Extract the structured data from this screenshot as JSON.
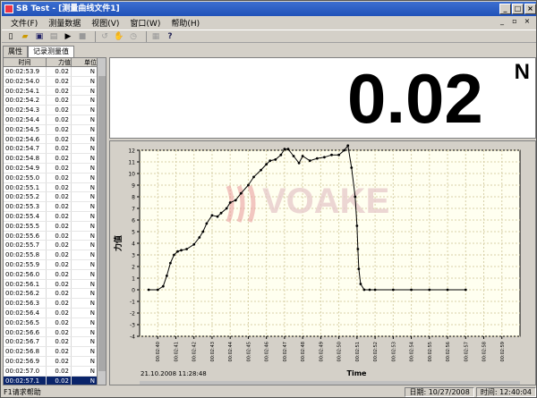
{
  "window": {
    "title": "SB Test - [测量曲线文件1]"
  },
  "menu": [
    "文件(F)",
    "测量数据",
    "视图(V)",
    "窗口(W)",
    "帮助(H)"
  ],
  "toolbar": [
    "new-icon",
    "open-icon",
    "save-icon",
    "print-icon",
    "play-icon",
    "stop-icon",
    "zoom-icon",
    "pan-icon",
    "refresh-icon",
    "export-icon",
    "help-icon"
  ],
  "tabs": [
    "属性",
    "记录测量值"
  ],
  "table": {
    "headers": [
      "时间",
      "力值",
      "单位"
    ],
    "rows": [
      [
        "00:02:53.9",
        "0.02",
        "N"
      ],
      [
        "00:02:54.0",
        "0.02",
        "N"
      ],
      [
        "00:02:54.1",
        "0.02",
        "N"
      ],
      [
        "00:02:54.2",
        "0.02",
        "N"
      ],
      [
        "00:02:54.3",
        "0.02",
        "N"
      ],
      [
        "00:02:54.4",
        "0.02",
        "N"
      ],
      [
        "00:02:54.5",
        "0.02",
        "N"
      ],
      [
        "00:02:54.6",
        "0.02",
        "N"
      ],
      [
        "00:02:54.7",
        "0.02",
        "N"
      ],
      [
        "00:02:54.8",
        "0.02",
        "N"
      ],
      [
        "00:02:54.9",
        "0.02",
        "N"
      ],
      [
        "00:02:55.0",
        "0.02",
        "N"
      ],
      [
        "00:02:55.1",
        "0.02",
        "N"
      ],
      [
        "00:02:55.2",
        "0.02",
        "N"
      ],
      [
        "00:02:55.3",
        "0.02",
        "N"
      ],
      [
        "00:02:55.4",
        "0.02",
        "N"
      ],
      [
        "00:02:55.5",
        "0.02",
        "N"
      ],
      [
        "00:02:55.6",
        "0.02",
        "N"
      ],
      [
        "00:02:55.7",
        "0.02",
        "N"
      ],
      [
        "00:02:55.8",
        "0.02",
        "N"
      ],
      [
        "00:02:55.9",
        "0.02",
        "N"
      ],
      [
        "00:02:56.0",
        "0.02",
        "N"
      ],
      [
        "00:02:56.1",
        "0.02",
        "N"
      ],
      [
        "00:02:56.2",
        "0.02",
        "N"
      ],
      [
        "00:02:56.3",
        "0.02",
        "N"
      ],
      [
        "00:02:56.4",
        "0.02",
        "N"
      ],
      [
        "00:02:56.5",
        "0.02",
        "N"
      ],
      [
        "00:02:56.6",
        "0.02",
        "N"
      ],
      [
        "00:02:56.7",
        "0.02",
        "N"
      ],
      [
        "00:02:56.8",
        "0.02",
        "N"
      ],
      [
        "00:02:56.9",
        "0.02",
        "N"
      ],
      [
        "00:02:57.0",
        "0.02",
        "N"
      ],
      [
        "00:02:57.1",
        "0.02",
        "N"
      ]
    ],
    "selected_index": 32
  },
  "display": {
    "value": "0.02",
    "unit": "N"
  },
  "watermark": "VOAKE",
  "chart_data": {
    "type": "line",
    "xlabel": "Time",
    "ylabel": "力值",
    "ylim": [
      -4,
      12
    ],
    "yticks": [
      -4,
      -3,
      -2,
      -1,
      0,
      1,
      2,
      3,
      4,
      5,
      6,
      7,
      8,
      9,
      10,
      11,
      12
    ],
    "xticks": [
      "00:02:40",
      "00:02:41",
      "00:02:42",
      "00:02:43",
      "00:02:44",
      "00:02:45",
      "00:02:46",
      "00:02:47",
      "00:02:48",
      "00:02:49",
      "00:02:50",
      "00:02:51",
      "00:02:52",
      "00:02:53",
      "00:02:54",
      "00:02:55",
      "00:02:56",
      "00:02:57",
      "00:02:58",
      "00:02:59"
    ],
    "timestamp": "21.10.2008  11:28:48",
    "series": [
      {
        "x": [
          39.5,
          40.0,
          40.3,
          40.5,
          40.7,
          40.9,
          41.1,
          41.3,
          41.6,
          42.0,
          42.3,
          42.5,
          42.7,
          43.0,
          43.3,
          43.5,
          43.8,
          44.0,
          44.3,
          44.6,
          45.0,
          45.3,
          45.7,
          46.0,
          46.2,
          46.5,
          46.8,
          47.0,
          47.2,
          47.5,
          47.8,
          48.0,
          48.4,
          48.8,
          49.2,
          49.6,
          50.0,
          50.3,
          50.5,
          50.7,
          50.9,
          51.0,
          51.05,
          51.1,
          51.2,
          51.4,
          51.7,
          52.0,
          53.0,
          54.0,
          55.0,
          56.0,
          57.0
        ],
        "y": [
          0.0,
          0.0,
          0.3,
          1.2,
          2.3,
          3.0,
          3.3,
          3.4,
          3.5,
          3.9,
          4.5,
          5.0,
          5.7,
          6.4,
          6.3,
          6.6,
          7.0,
          7.5,
          7.7,
          8.3,
          9.0,
          9.7,
          10.3,
          10.8,
          11.1,
          11.2,
          11.6,
          12.1,
          12.1,
          11.5,
          10.9,
          11.5,
          11.1,
          11.3,
          11.4,
          11.6,
          11.6,
          12.0,
          12.4,
          10.5,
          8.0,
          5.5,
          3.5,
          1.8,
          0.5,
          0.0,
          0.0,
          0.0,
          0.0,
          0.0,
          0.0,
          0.0,
          0.0
        ]
      }
    ]
  },
  "status": {
    "hint": "F1请求帮助",
    "date_label": "日期: 10/27/2008",
    "time_label": "时间: 12:40:04"
  }
}
